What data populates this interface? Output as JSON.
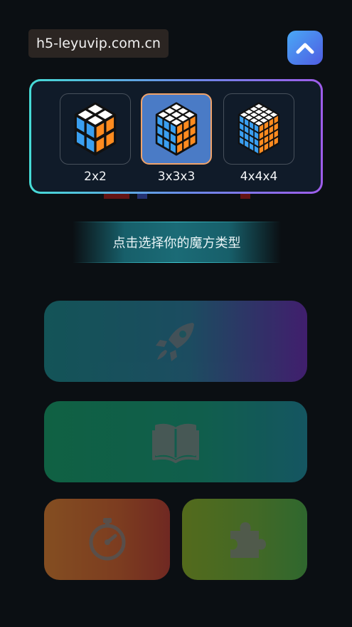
{
  "overlay": {
    "url": "h5-leyuvip.com.cn"
  },
  "cube_selector": {
    "options": [
      {
        "label": "2x2",
        "grid": 2,
        "selected": false
      },
      {
        "label": "3x3x3",
        "grid": 3,
        "selected": true
      },
      {
        "label": "4x4x4",
        "grid": 4,
        "selected": false
      }
    ]
  },
  "prompt": {
    "text": "点击选择你的魔方类型"
  },
  "menu": {
    "items": [
      {
        "icon": "rocket-icon",
        "color": "#1a8c8f"
      },
      {
        "icon": "book-icon",
        "color": "#14a46a"
      },
      {
        "icon": "stopwatch-icon",
        "color": "#e7822e"
      },
      {
        "icon": "puzzle-icon",
        "color": "#8fb624"
      }
    ]
  },
  "colors": {
    "cube_top": "#ffffff",
    "cube_left": "#3a9ff0",
    "cube_right": "#ff8b1f",
    "selected_border": "#f0a36a",
    "selected_fill": "#4a7bc6",
    "panel_border_start": "#46dbd6",
    "panel_border_end": "#9e5cea"
  }
}
